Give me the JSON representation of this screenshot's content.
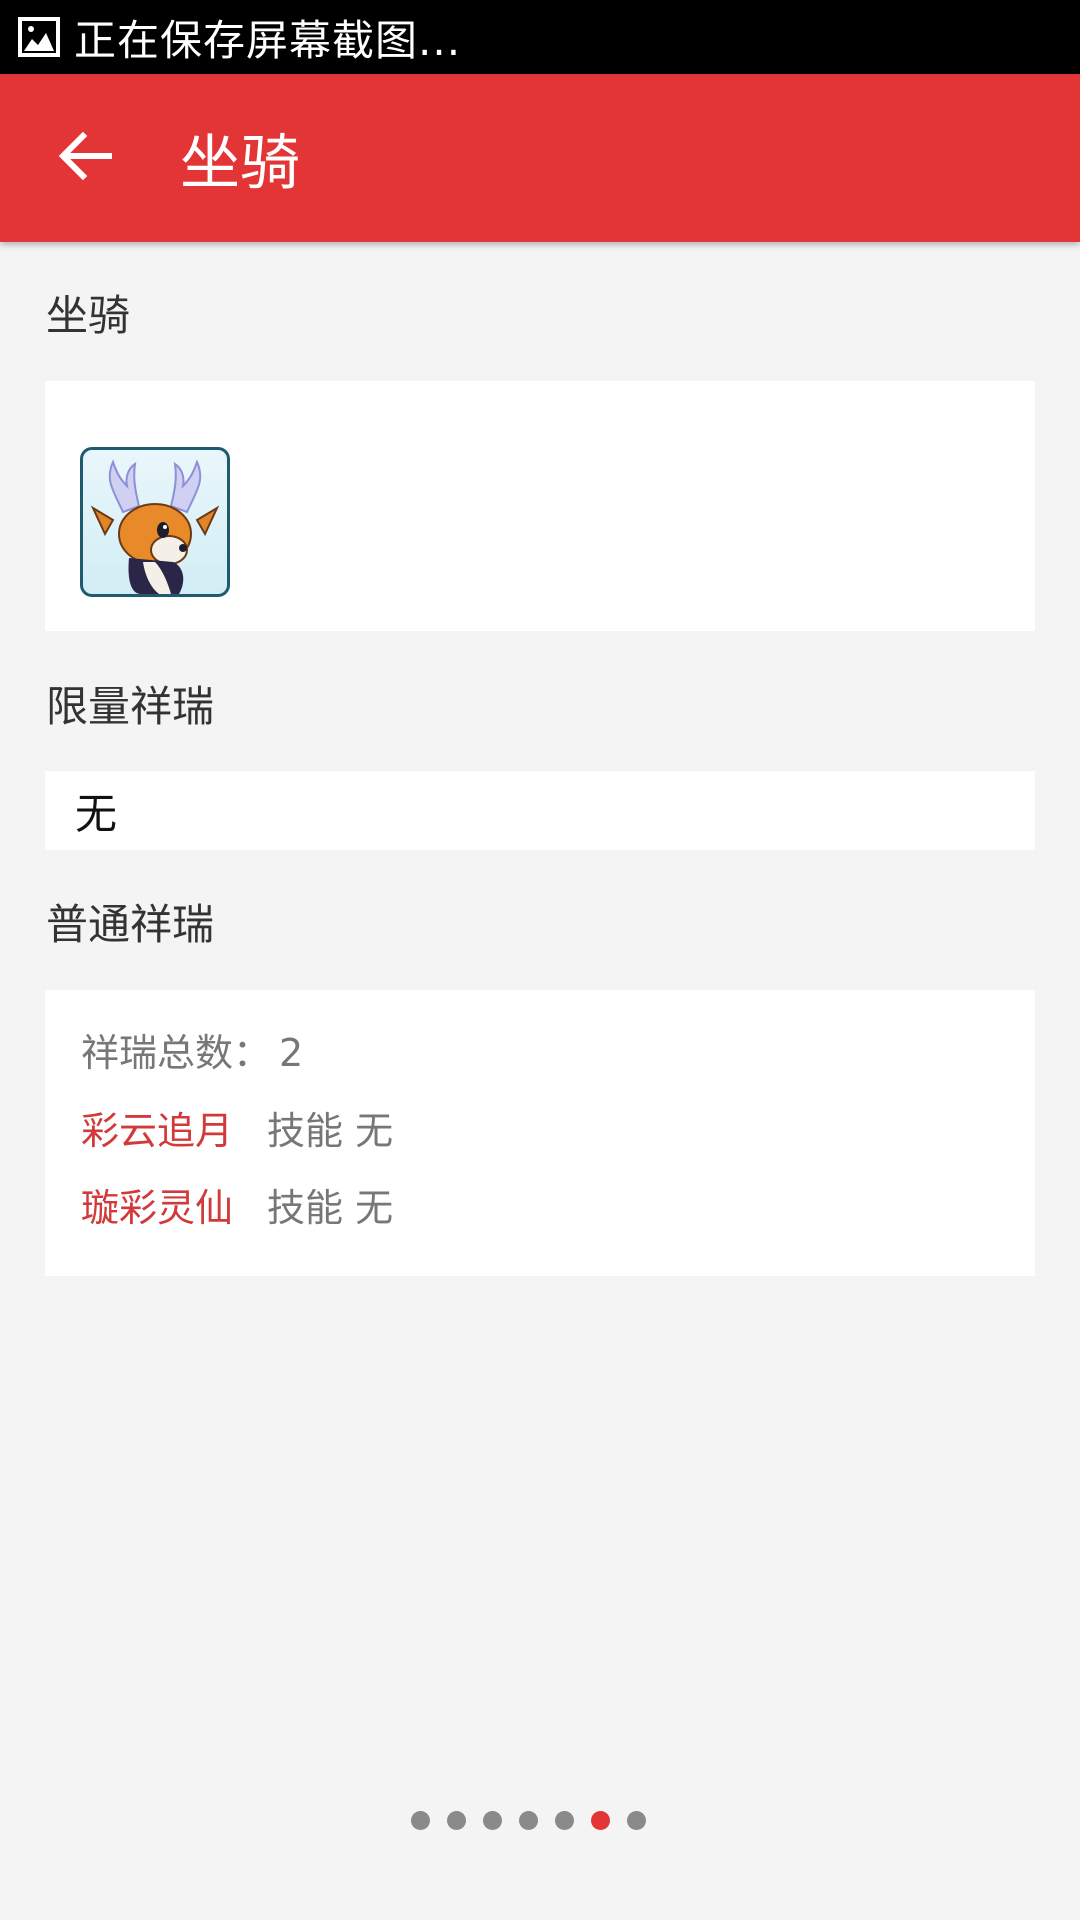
{
  "status_bar": {
    "notification_icon": "image-icon",
    "text": "正在保存屏幕截图..."
  },
  "app_bar": {
    "back_icon": "arrow-left-icon",
    "title": "坐骑",
    "color": "#e33535"
  },
  "sections": {
    "mount": {
      "header": "坐骑",
      "icon": "deer-mount-icon"
    },
    "limited": {
      "header": "限量祥瑞",
      "value": "无"
    },
    "normal": {
      "header": "普通祥瑞",
      "count_label": "祥瑞总数：",
      "count_value": "2",
      "items": [
        {
          "name": "彩云追月",
          "skill": "技能 无"
        },
        {
          "name": "璇彩灵仙",
          "skill": "技能 无"
        }
      ]
    }
  },
  "pager": {
    "total": 7,
    "active_index": 5,
    "active_color": "#e33535"
  }
}
